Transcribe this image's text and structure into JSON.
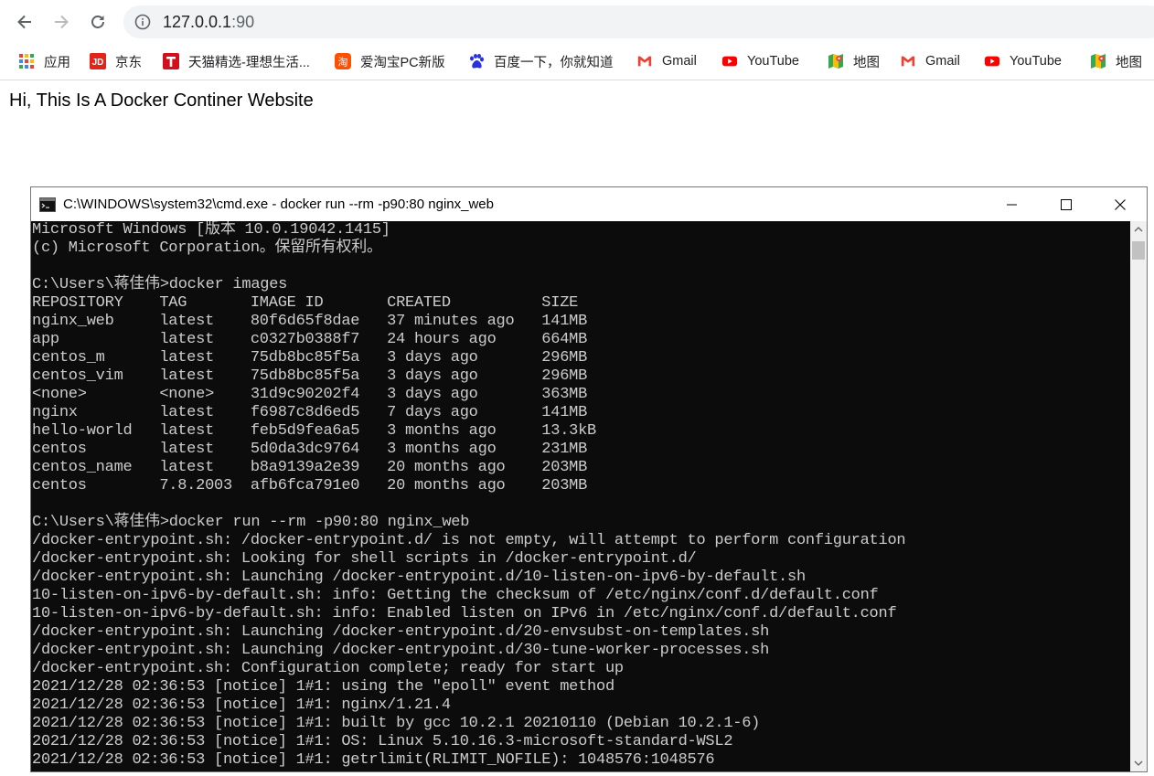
{
  "browser": {
    "url_host": "127.0.0.1",
    "url_port": ":90"
  },
  "bookmarks": [
    {
      "label": "应用",
      "icon": "apps-grid-icon"
    },
    {
      "label": "京东",
      "icon": "jd-icon"
    },
    {
      "label": "天猫精选-理想生活...",
      "icon": "tmall-icon"
    },
    {
      "label": "爱淘宝PC新版",
      "icon": "taobao-icon"
    },
    {
      "label": "百度一下，你就知道",
      "icon": "baidu-paw-icon"
    },
    {
      "label": "Gmail",
      "icon": "gmail-icon"
    },
    {
      "label": "YouTube",
      "icon": "youtube-icon"
    },
    {
      "label": "地图",
      "icon": "maps-icon"
    },
    {
      "label": "Gmail",
      "icon": "gmail-icon"
    },
    {
      "label": "YouTube",
      "icon": "youtube-icon"
    },
    {
      "label": "地图",
      "icon": "maps-icon"
    }
  ],
  "page": {
    "heading": "Hi, This Is A Docker Continer Website"
  },
  "cmd": {
    "title": "C:\\WINDOWS\\system32\\cmd.exe - docker  run --rm -p90:80 nginx_web",
    "lines": [
      "Microsoft Windows [版本 10.0.19042.1415]",
      "(c) Microsoft Corporation。保留所有权利。",
      "",
      "C:\\Users\\蒋佳伟>docker images",
      "REPOSITORY    TAG       IMAGE ID       CREATED          SIZE",
      "nginx_web     latest    80f6d65f8dae   37 minutes ago   141MB",
      "app           latest    c0327b0388f7   24 hours ago     664MB",
      "centos_m      latest    75db8bc85f5a   3 days ago       296MB",
      "centos_vim    latest    75db8bc85f5a   3 days ago       296MB",
      "<none>        <none>    31d9c90202f4   3 days ago       363MB",
      "nginx         latest    f6987c8d6ed5   7 days ago       141MB",
      "hello-world   latest    feb5d9fea6a5   3 months ago     13.3kB",
      "centos        latest    5d0da3dc9764   3 months ago     231MB",
      "centos_name   latest    b8a9139a2e39   20 months ago    203MB",
      "centos        7.8.2003  afb6fca791e0   20 months ago    203MB",
      "",
      "C:\\Users\\蒋佳伟>docker run --rm -p90:80 nginx_web",
      "/docker-entrypoint.sh: /docker-entrypoint.d/ is not empty, will attempt to perform configuration",
      "/docker-entrypoint.sh: Looking for shell scripts in /docker-entrypoint.d/",
      "/docker-entrypoint.sh: Launching /docker-entrypoint.d/10-listen-on-ipv6-by-default.sh",
      "10-listen-on-ipv6-by-default.sh: info: Getting the checksum of /etc/nginx/conf.d/default.conf",
      "10-listen-on-ipv6-by-default.sh: info: Enabled listen on IPv6 in /etc/nginx/conf.d/default.conf",
      "/docker-entrypoint.sh: Launching /docker-entrypoint.d/20-envsubst-on-templates.sh",
      "/docker-entrypoint.sh: Launching /docker-entrypoint.d/30-tune-worker-processes.sh",
      "/docker-entrypoint.sh: Configuration complete; ready for start up",
      "2021/12/28 02:36:53 [notice] 1#1: using the \"epoll\" event method",
      "2021/12/28 02:36:53 [notice] 1#1: nginx/1.21.4",
      "2021/12/28 02:36:53 [notice] 1#1: built by gcc 10.2.1 20210110 (Debian 10.2.1-6)",
      "2021/12/28 02:36:53 [notice] 1#1: OS: Linux 5.10.16.3-microsoft-standard-WSL2",
      "2021/12/28 02:36:53 [notice] 1#1: getrlimit(RLIMIT_NOFILE): 1048576:1048576"
    ]
  }
}
